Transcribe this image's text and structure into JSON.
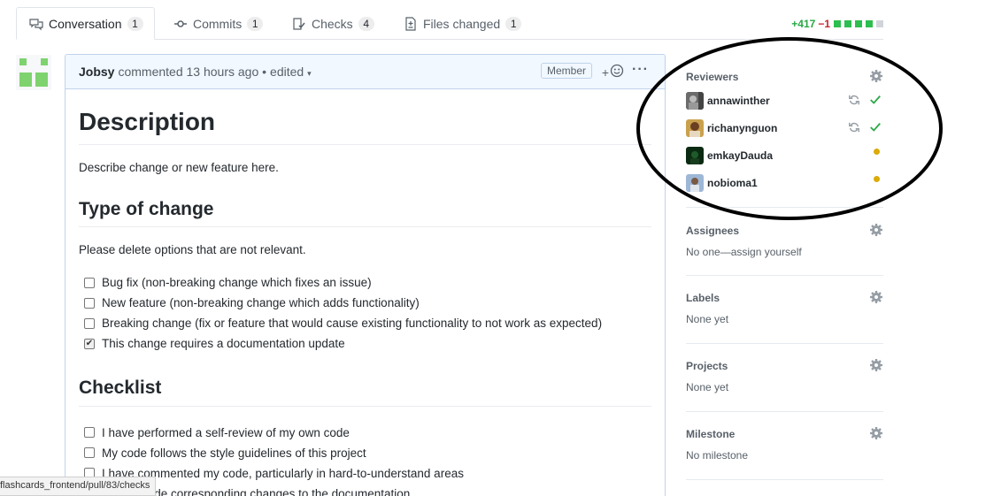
{
  "tabs": [
    {
      "label": "Conversation",
      "count": "1",
      "icon": "comment-discussion-icon"
    },
    {
      "label": "Commits",
      "count": "1",
      "icon": "git-commit-icon"
    },
    {
      "label": "Checks",
      "count": "4",
      "icon": "checklist-icon"
    },
    {
      "label": "Files changed",
      "count": "1",
      "icon": "file-diff-icon"
    }
  ],
  "diffstat": {
    "additions": "+417",
    "deletions": "−1"
  },
  "comment": {
    "author": "Jobsy",
    "action": "commented",
    "time": "13 hours ago",
    "separator": "•",
    "edited": "edited",
    "member_label": "Member",
    "react_plus": "+",
    "more": "···"
  },
  "body": {
    "h_description": "Description",
    "description_text": "Describe change or new feature here.",
    "h_type": "Type of change",
    "type_intro": "Please delete options that are not relevant.",
    "type_tasks": [
      {
        "label": "Bug fix (non-breaking change which fixes an issue)",
        "checked": false
      },
      {
        "label": "New feature (non-breaking change which adds functionality)",
        "checked": false
      },
      {
        "label": "Breaking change (fix or feature that would cause existing functionality to not work as expected)",
        "checked": false
      },
      {
        "label": "This change requires a documentation update",
        "checked": true
      }
    ],
    "h_checklist": "Checklist",
    "checklist_tasks": [
      {
        "label": "I have performed a self-review of my own code",
        "checked": false
      },
      {
        "label": "My code follows the style guidelines of this project",
        "checked": false
      },
      {
        "label": "I have commented my code, particularly in hard-to-understand areas",
        "checked": false
      },
      {
        "label": "I have made corresponding changes to the documentation",
        "checked": false
      }
    ]
  },
  "sidebar": {
    "reviewers": {
      "title": "Reviewers",
      "people": [
        {
          "name": "annawinther",
          "status": "approved"
        },
        {
          "name": "richanynguon",
          "status": "approved"
        },
        {
          "name": "emkayDauda",
          "status": "pending"
        },
        {
          "name": "nobioma1",
          "status": "pending"
        }
      ]
    },
    "assignees": {
      "title": "Assignees",
      "text": "No one—assign yourself"
    },
    "labels": {
      "title": "Labels",
      "text": "None yet"
    },
    "projects": {
      "title": "Projects",
      "text": "None yet"
    },
    "milestone": {
      "title": "Milestone",
      "text": "No milestone"
    }
  },
  "statusbar": {
    "url": "flashcards_frontend/pull/83/checks"
  },
  "colors": {
    "green": "#28a745",
    "red": "#cb2431",
    "pending": "#dbab09",
    "link_blue": "#0366d6"
  }
}
